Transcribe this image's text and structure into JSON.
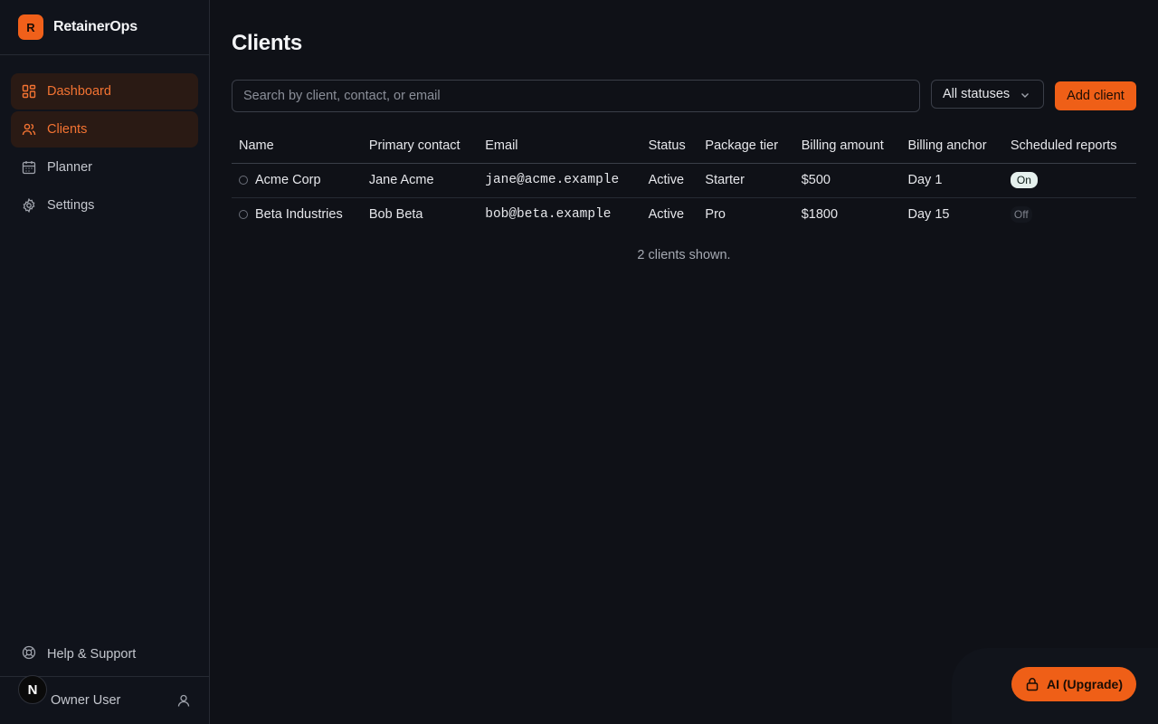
{
  "brand": {
    "logo_letter": "R",
    "name": "RetainerOps"
  },
  "nav": {
    "items": [
      {
        "label": "Dashboard",
        "icon": "dashboard-grid-icon"
      },
      {
        "label": "Clients",
        "icon": "users-icon"
      },
      {
        "label": "Planner",
        "icon": "calendar-icon"
      },
      {
        "label": "Settings",
        "icon": "gear-icon"
      }
    ],
    "help_label": "Help & Support"
  },
  "user": {
    "avatar_letter": "N",
    "name": "Owner User"
  },
  "page": {
    "title": "Clients"
  },
  "search": {
    "placeholder": "Search by client, contact, or email",
    "value": ""
  },
  "filter": {
    "selected": "All statuses"
  },
  "toolbar": {
    "add_label": "Add client"
  },
  "table": {
    "columns": [
      "Name",
      "Primary contact",
      "Email",
      "Status",
      "Package tier",
      "Billing amount",
      "Billing anchor",
      "Scheduled reports"
    ],
    "rows": [
      {
        "name": "Acme Corp",
        "contact": "Jane Acme",
        "email": "jane@acme.example",
        "status": "Active",
        "tier": "Starter",
        "amount": "$500",
        "anchor": "Day 1",
        "reports": "On"
      },
      {
        "name": "Beta Industries",
        "contact": "Bob Beta",
        "email": "bob@beta.example",
        "status": "Active",
        "tier": "Pro",
        "amount": "$1800",
        "anchor": "Day 15",
        "reports": "Off"
      }
    ]
  },
  "footer": {
    "count_text": "2 clients shown."
  },
  "ai": {
    "label": "AI (Upgrade)"
  },
  "colors": {
    "accent": "#ef5f17",
    "background": "#0f1117",
    "sidebar": "#10131b"
  }
}
